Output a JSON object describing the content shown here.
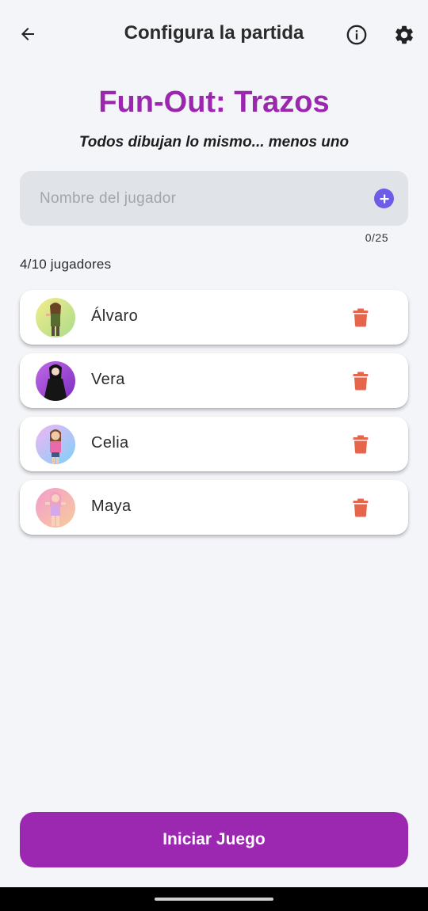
{
  "appbar": {
    "title": "Configura la partida",
    "back_icon": "arrow-left-icon",
    "info_icon": "info-icon",
    "settings_icon": "gear-icon"
  },
  "game": {
    "title": "Fun-Out: Trazos",
    "subtitle": "Todos dibujan lo mismo... menos uno"
  },
  "name_input": {
    "placeholder": "Nombre del jugador",
    "value": "",
    "counter": "0/25",
    "add_icon": "plus-circle-icon"
  },
  "players_count": "4/10 jugadores",
  "players": [
    {
      "name": "Álvaro",
      "avatar_colors": [
        "#f4ec8a",
        "#a9dc8c"
      ]
    },
    {
      "name": "Vera",
      "avatar_colors": [
        "#c06ae8",
        "#7c2bc1"
      ]
    },
    {
      "name": "Celia",
      "avatar_colors": [
        "#f0b6f4",
        "#7fd0f7"
      ]
    },
    {
      "name": "Maya",
      "avatar_colors": [
        "#f49ccf",
        "#f7cc9a"
      ]
    }
  ],
  "start_button": "Iniciar Juego",
  "colors": {
    "accent": "#9c27b0",
    "add_button": "#6c5ce7",
    "delete_icon": "#e5664b",
    "background": "#f4f5f9"
  }
}
